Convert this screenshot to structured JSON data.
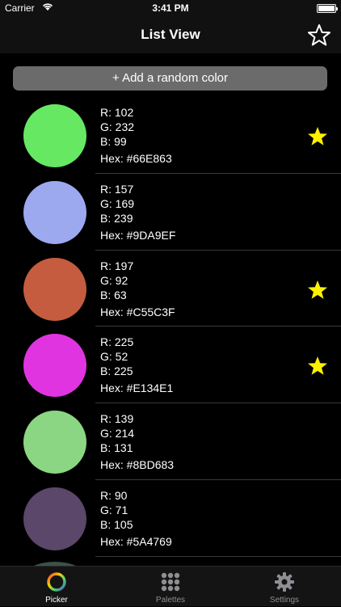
{
  "status_bar": {
    "carrier": "Carrier",
    "time": "3:41 PM"
  },
  "nav": {
    "title": "List View",
    "right_icon": "star-outline-icon"
  },
  "add_button": {
    "label": "+ Add a random color"
  },
  "colors": [
    {
      "r": "R: 102",
      "g": "G: 232",
      "b": "B: 99",
      "hex": "Hex: #66E863",
      "swatch": "#66E863",
      "favorite": true
    },
    {
      "r": "R: 157",
      "g": "G: 169",
      "b": "B: 239",
      "hex": "Hex: #9DA9EF",
      "swatch": "#9DA9EF",
      "favorite": false
    },
    {
      "r": "R: 197",
      "g": "G: 92",
      "b": "B: 63",
      "hex": "Hex: #C55C3F",
      "swatch": "#C55C3F",
      "favorite": true
    },
    {
      "r": "R: 225",
      "g": "G: 52",
      "b": "B: 225",
      "hex": "Hex: #E134E1",
      "swatch": "#E134E1",
      "favorite": true
    },
    {
      "r": "R: 139",
      "g": "G: 214",
      "b": "B: 131",
      "hex": "Hex: #8BD683",
      "swatch": "#8BD683",
      "favorite": false
    },
    {
      "r": "R: 90",
      "g": "G: 71",
      "b": "B: 105",
      "hex": "Hex: #5A4769",
      "swatch": "#5A4769",
      "favorite": false
    }
  ],
  "star_color": "#FFF000",
  "tabs": [
    {
      "label": "Picker",
      "icon": "color-wheel-icon",
      "active": true
    },
    {
      "label": "Palettes",
      "icon": "grid-dots-icon",
      "active": false
    },
    {
      "label": "Settings",
      "icon": "gear-icon",
      "active": false
    }
  ]
}
